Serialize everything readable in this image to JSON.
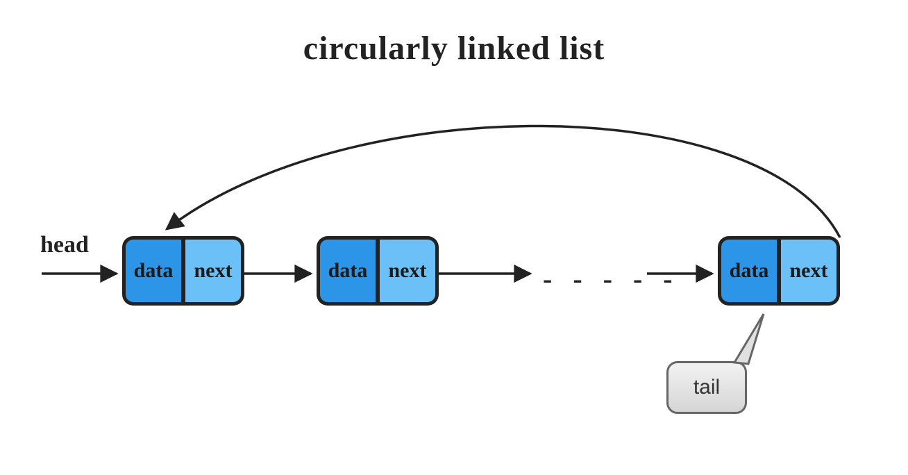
{
  "title": "circularly linked list",
  "labels": {
    "head": "head",
    "tail": "tail",
    "ellipsis": "- - - - -"
  },
  "nodes": [
    {
      "data": "data",
      "next": "next"
    },
    {
      "data": "data",
      "next": "next"
    },
    {
      "data": "data",
      "next": "next"
    }
  ],
  "colors": {
    "dataFill": "#2c95e8",
    "nextFill": "#6bc1f7",
    "stroke": "#222222",
    "tailFillTop": "#f2f2f2",
    "tailFillBottom": "#d6d6d6"
  }
}
